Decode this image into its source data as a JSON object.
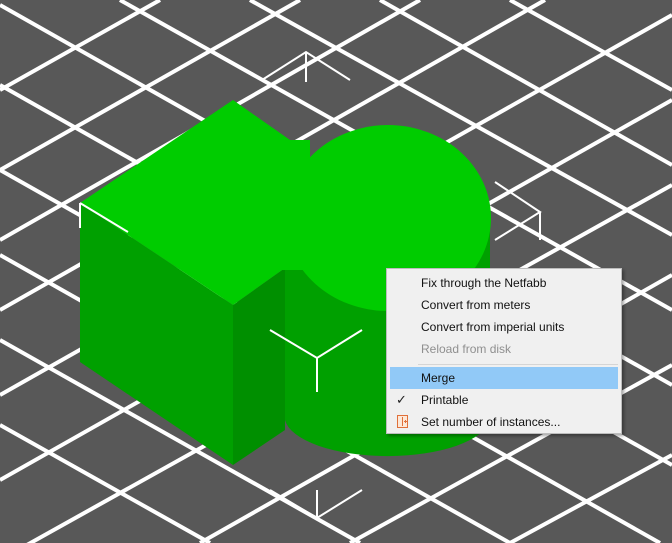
{
  "colors": {
    "background": "#585858",
    "grid": "#ffffff",
    "object_top": "#00cc00",
    "object_side": "#009d00",
    "object_front": "#00a800",
    "menu_highlight": "#91c9f7"
  },
  "context_menu": {
    "items": [
      {
        "label": "Fix through the Netfabb",
        "enabled": true
      },
      {
        "label": "Convert from meters",
        "enabled": true
      },
      {
        "label": "Convert from imperial units",
        "enabled": true
      },
      {
        "label": "Reload from disk",
        "enabled": false
      },
      {
        "label": "Merge",
        "enabled": true,
        "highlighted": true
      },
      {
        "label": "Printable",
        "enabled": true,
        "checked": true,
        "icon": "check-icon"
      },
      {
        "label": "Set number of instances...",
        "enabled": true,
        "icon": "instances-icon"
      }
    ]
  }
}
